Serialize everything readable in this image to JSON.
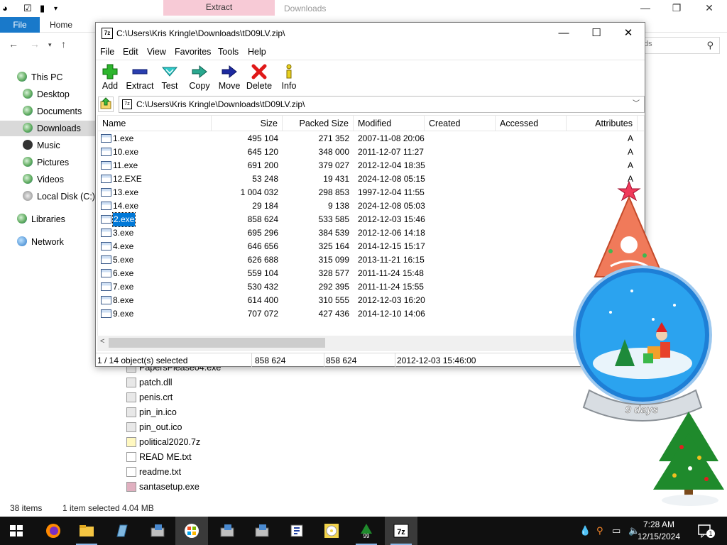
{
  "explorer": {
    "title": "Downloads",
    "contextual_tab": "Extract",
    "ribbon_file": "File",
    "ribbon_home": "Home",
    "search_placeholder": "ds",
    "nav": [
      {
        "label": "This PC"
      },
      {
        "label": "Desktop"
      },
      {
        "label": "Documents"
      },
      {
        "label": "Downloads"
      },
      {
        "label": "Music"
      },
      {
        "label": "Pictures"
      },
      {
        "label": "Videos"
      },
      {
        "label": "Local Disk (C:)"
      },
      {
        "label": "Libraries"
      },
      {
        "label": "Network"
      }
    ],
    "files": [
      {
        "name": "PapersPlease04.exe"
      },
      {
        "name": "patch.dll"
      },
      {
        "name": "penis.crt"
      },
      {
        "name": "pin_in.ico"
      },
      {
        "name": "pin_out.ico"
      },
      {
        "name": "political2020.7z"
      },
      {
        "name": "READ ME.txt"
      },
      {
        "name": "readme.txt"
      },
      {
        "name": "santasetup.exe"
      }
    ],
    "status_items": "38 items",
    "status_selected": "1 item selected  4.04 MB"
  },
  "sevenzip": {
    "title": "C:\\Users\\Kris Kringle\\Downloads\\tD09LV.zip\\",
    "app_icon": "7z",
    "menu": [
      "File",
      "Edit",
      "View",
      "Favorites",
      "Tools",
      "Help"
    ],
    "toolbar": [
      {
        "label": "Add",
        "icon": "add-icon"
      },
      {
        "label": "Extract",
        "icon": "extract-icon"
      },
      {
        "label": "Test",
        "icon": "test-icon"
      },
      {
        "label": "Copy",
        "icon": "copy-icon"
      },
      {
        "label": "Move",
        "icon": "move-icon"
      },
      {
        "label": "Delete",
        "icon": "delete-icon"
      },
      {
        "label": "Info",
        "icon": "info-icon"
      }
    ],
    "path": "C:\\Users\\Kris Kringle\\Downloads\\tD09LV.zip\\",
    "columns": [
      "Name",
      "Size",
      "Packed Size",
      "Modified",
      "Created",
      "Accessed",
      "Attributes"
    ],
    "rows": [
      {
        "name": "1.exe",
        "size": "495 104",
        "packed": "271 352",
        "modified": "2007-11-08 20:06",
        "attr": "A"
      },
      {
        "name": "10.exe",
        "size": "645 120",
        "packed": "348 000",
        "modified": "2011-12-07 11:27",
        "attr": "A"
      },
      {
        "name": "11.exe",
        "size": "691 200",
        "packed": "379 027",
        "modified": "2012-12-04 18:35",
        "attr": "A"
      },
      {
        "name": "12.EXE",
        "size": "53 248",
        "packed": "19 431",
        "modified": "2024-12-08 05:15",
        "attr": "A"
      },
      {
        "name": "13.exe",
        "size": "1 004 032",
        "packed": "298 853",
        "modified": "1997-12-04 11:55",
        "attr": "A"
      },
      {
        "name": "14.exe",
        "size": "29 184",
        "packed": "9 138",
        "modified": "2024-12-08 05:03",
        "attr": "A"
      },
      {
        "name": "2.exe",
        "size": "858 624",
        "packed": "533 585",
        "modified": "2012-12-03 15:46",
        "attr": "A"
      },
      {
        "name": "3.exe",
        "size": "695 296",
        "packed": "384 539",
        "modified": "2012-12-06 14:18",
        "attr": "A"
      },
      {
        "name": "4.exe",
        "size": "646 656",
        "packed": "325 164",
        "modified": "2014-12-15 15:17",
        "attr": "A"
      },
      {
        "name": "5.exe",
        "size": "626 688",
        "packed": "315 099",
        "modified": "2013-11-21 16:15",
        "attr": "A"
      },
      {
        "name": "6.exe",
        "size": "559 104",
        "packed": "328 577",
        "modified": "2011-11-24 15:48",
        "attr": "A"
      },
      {
        "name": "7.exe",
        "size": "530 432",
        "packed": "292 395",
        "modified": "2011-11-24 15:55",
        "attr": "A"
      },
      {
        "name": "8.exe",
        "size": "614 400",
        "packed": "310 555",
        "modified": "2012-12-03 16:20",
        "attr": "A"
      },
      {
        "name": "9.exe",
        "size": "707 072",
        "packed": "427 436",
        "modified": "2014-12-10 14:06",
        "attr": "A"
      }
    ],
    "selected_index": 6,
    "status": {
      "selection": "1 / 14 object(s) selected",
      "size": "858 624",
      "packed": "858 624",
      "modified": "2012-12-03 15:46:00"
    }
  },
  "snowglobe": {
    "days": "9 days"
  },
  "taskbar": {
    "apps": [
      "start-icon",
      "firefox-icon",
      "file-explorer-icon",
      "notepad-icon",
      "setup-icon",
      "windows-xp-icon",
      "setup-icon-2",
      "setup-icon-3",
      "installer-icon",
      "disc-icon",
      "christmas-tree-99-icon",
      "7zip-icon"
    ],
    "tree_badge": "99",
    "sevenzip_badge": "7z",
    "time": "7:28 AM",
    "date": "12/15/2024",
    "notification_count": "1"
  }
}
